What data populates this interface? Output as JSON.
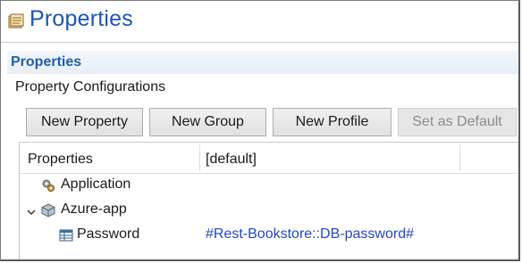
{
  "window": {
    "title": "Properties"
  },
  "section": {
    "title": "Properties",
    "subtitle": "Property Configurations"
  },
  "toolbar": {
    "new_property": "New Property",
    "new_group": "New Group",
    "new_profile": "New Profile",
    "set_default": "Set as Default"
  },
  "table": {
    "columns": [
      "Properties",
      "[default]"
    ],
    "rows": [
      {
        "label": "Application",
        "value": "",
        "icon": "gear-cluster-icon"
      },
      {
        "label": "Azure-app",
        "value": "",
        "icon": "cube-icon",
        "expanded": true
      },
      {
        "label": "Password",
        "value": "#Rest-Bookstore::DB-password#",
        "icon": "table-icon"
      }
    ]
  },
  "colors": {
    "title_blue": "#1a55b8",
    "section_blue": "#1f5fa8",
    "value_blue": "#2146c7"
  }
}
